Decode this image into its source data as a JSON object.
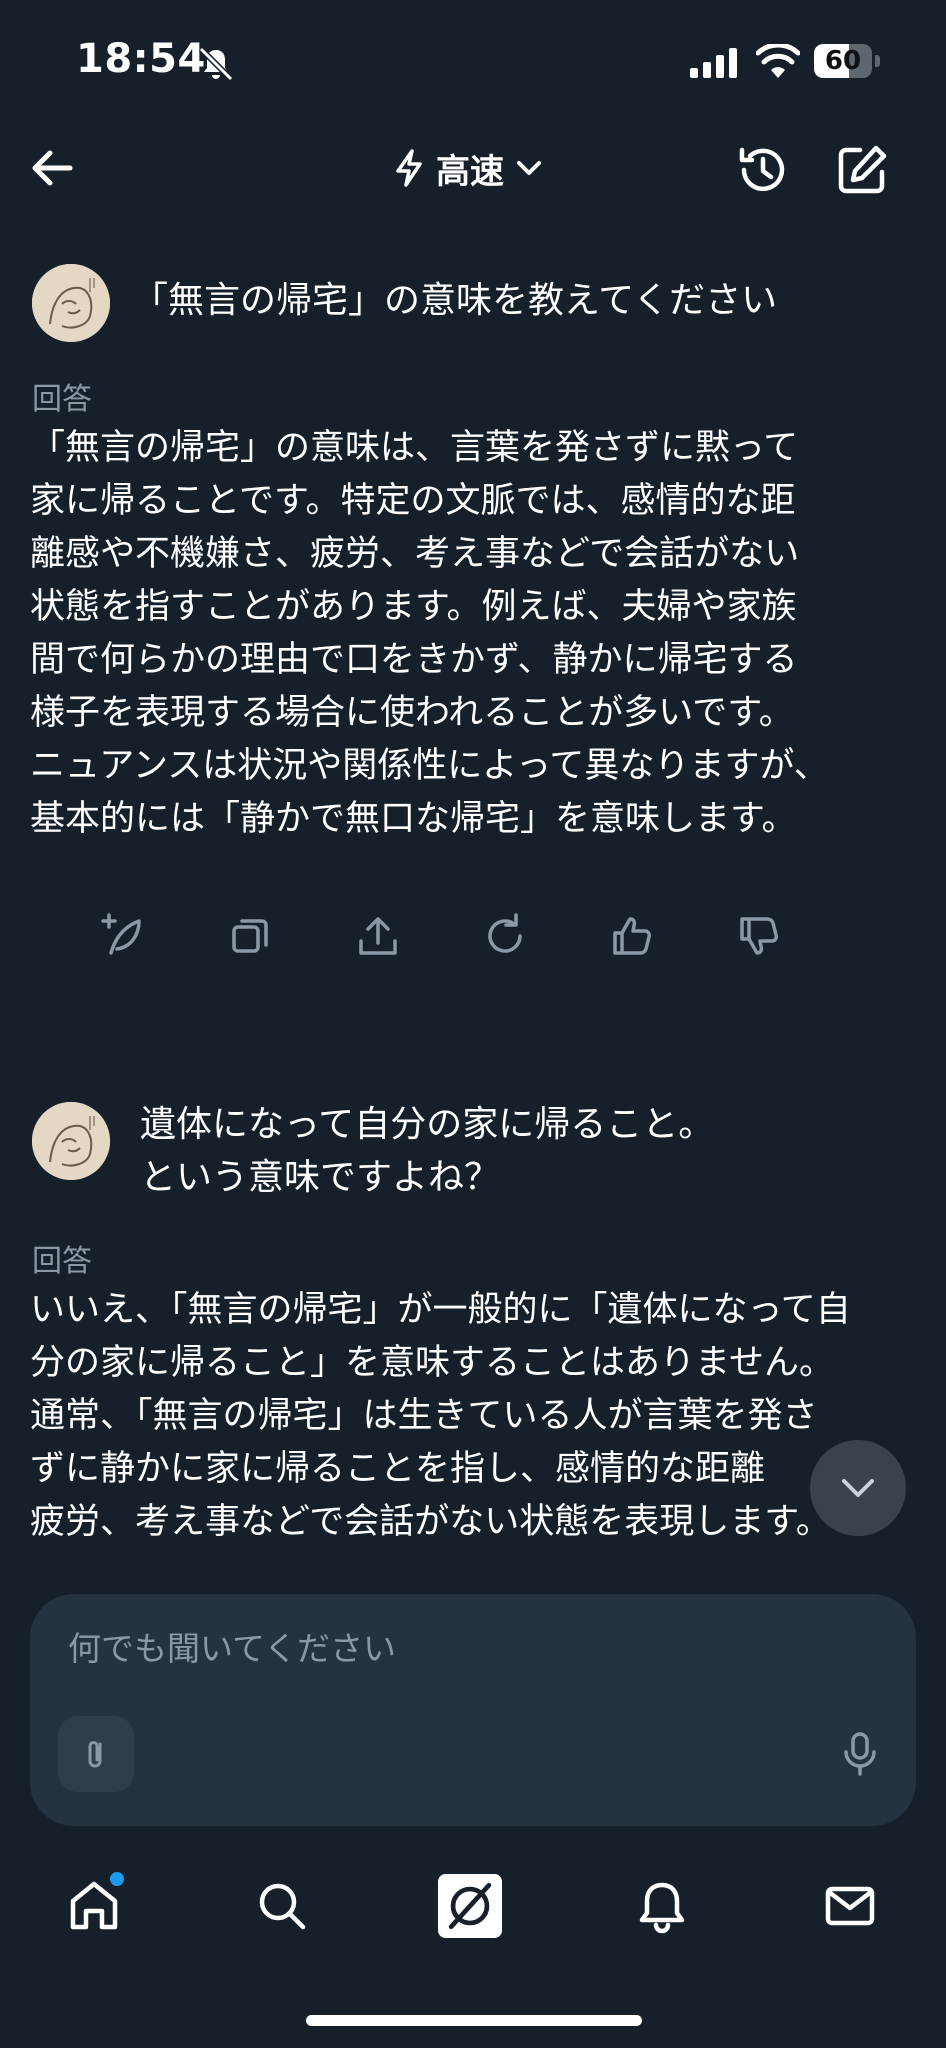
{
  "status": {
    "time": "18:54",
    "battery": "60",
    "battery_level": 0.6
  },
  "header": {
    "mode": "高速"
  },
  "chat": [
    {
      "user": "「無言の帰宅」の意味を教えてください",
      "answer_label": "回答",
      "answer": "「無言の帰宅」の意味は、言葉を発さずに黙って\n家に帰ることです。特定の文脈では、感情的な距\n離感や不機嫌さ、疲労、考え事などで会話がない\n状態を指すことがあります。例えば、夫婦や家族\n間で何らかの理由で口をきかず、静かに帰宅する\n様子を表現する場合に使われることが多いです。\nニュアンスは状況や関係性によって異なりますが、\n基本的には「静かで無口な帰宅」を意味します。"
    },
    {
      "user": "遺体になって自分の家に帰ること。\nという意味ですよね？",
      "answer_label": "回答",
      "answer": "いいえ、「無言の帰宅」が一般的に「遺体になって自\n分の家に帰ること」を意味することはありません。\n通常、「無言の帰宅」は生きている人が言葉を発さ\nずに静かに家に帰ることを指し、感情的な距離\n疲労、考え事などで会話がない状態を表現します。"
    }
  ],
  "composer": {
    "placeholder": "何でも聞いてください"
  },
  "colors": {
    "background": "#15202b",
    "accent": "#1d9bf0",
    "muted": "#8b98a5",
    "composer": "#253341"
  },
  "icons": {
    "actions": [
      "new-post-icon",
      "copy-icon",
      "share-icon",
      "regenerate-icon",
      "thumbs-up-icon",
      "thumbs-down-icon"
    ],
    "tabs": [
      "home-icon",
      "search-icon",
      "grok-icon",
      "notifications-icon",
      "messages-icon"
    ]
  }
}
